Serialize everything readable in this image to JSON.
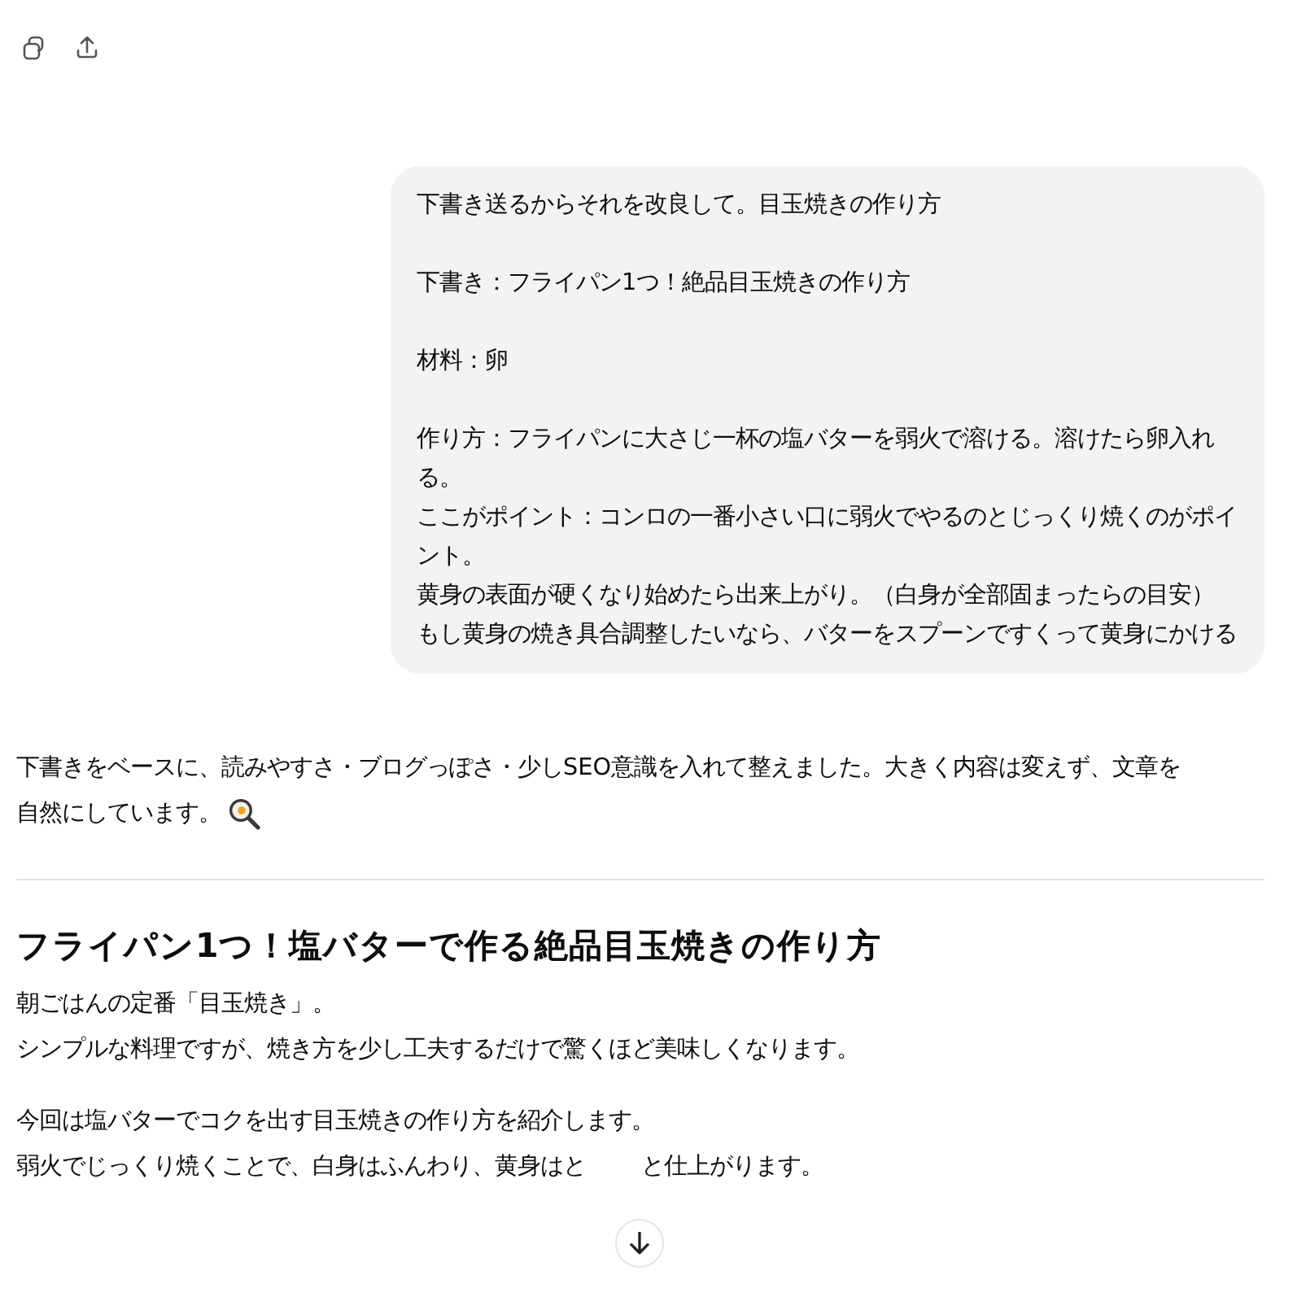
{
  "toolbar": [
    {
      "kind": "copy"
    },
    {
      "kind": "share"
    }
  ],
  "user_message": {
    "paragraphs": [
      [
        "下書き送るからそれを改良して。目玉焼きの作り方"
      ],
      [
        "下書き：フライパン1つ！絶品目玉焼きの作り方"
      ],
      [
        "材料：卵"
      ],
      [
        "作り方：フライパンに大さじ一杯の塩バターを弱火で溶ける。溶けたら卵入れる。",
        "ここがポイント：コンロの一番小さい口に弱火でやるのとじっくり焼くのがポイント。",
        "黄身の表面が硬くなり始めたら出来上がり。（白身が全部固まったらの目安）",
        "もし黄身の焼き具合調整したいなら、バターをスプーンですくって黄身にかける"
      ]
    ]
  },
  "assistant": {
    "intro": [
      "下書きをベースに、読みやすさ・ブログっぽさ・少しSEO意識を入れて整えました。大きく内容は変えず、文章を",
      "自然にしています。"
    ],
    "heading": "フライパン1つ！塩バターで作る絶品目玉焼きの作り方",
    "paragraphs": [
      {
        "lines": [
          [
            "朝ごはんの定番「目玉焼き」。"
          ],
          [
            "シンプルな料理ですが、焼き方を少し工夫するだけで驚くほど美味しくなります。"
          ]
        ]
      },
      {
        "lines": [
          [
            "今回は塩バターでコクを出す目玉焼きの作り方を紹介します。"
          ],
          [
            "弱火でじっくり焼くことで、白身はふんわり、黄身はと",
            "と仕上がります。"
          ]
        ]
      }
    ]
  },
  "scroll_down": {
    "kind": "arrow"
  }
}
